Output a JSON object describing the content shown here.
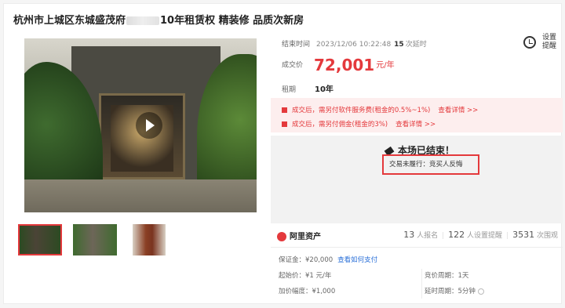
{
  "title_left": "杭州市上城区东城盛茂府",
  "title_right": "10年租赁权 精装修 品质次新房",
  "end_time": {
    "label": "结束时间",
    "value": "2023/12/06 10:22:48",
    "delay_count": "15",
    "delay_label": "次延时"
  },
  "price": {
    "label": "成交价",
    "value": "72,001",
    "unit": "元/年"
  },
  "term": {
    "label": "租期",
    "value": "10年"
  },
  "remind": {
    "label": "设置提醒",
    "icon": "alarm-clock-icon"
  },
  "fees": [
    {
      "text": "成交后，需另付软件服务费(租金的0.5%~1%)",
      "link": "查看详情 >>"
    },
    {
      "text": "成交后，需另付佣金(租金的3%)",
      "link": "查看详情 >>"
    }
  ],
  "ended": {
    "title": "本场已结束！",
    "reason": "交易未履行：竞买人反悔"
  },
  "brand": "阿里资产",
  "stats": {
    "signups": "13",
    "signups_label": "人报名",
    "reminders": "122",
    "reminders_label": "人设置提醒",
    "views": "3531",
    "views_label": "次围观"
  },
  "details": {
    "deposit_label": "保证金：¥20,000",
    "deposit_link": "查看如何支付",
    "start_label": "起始价：¥1 元/年",
    "bid_cycle": "竞价周期：1天",
    "increment": "加价幅度：¥1,000",
    "delay_cycle": "延时周期：5分钟"
  },
  "colors": {
    "accent": "#e4393c",
    "link": "#2b70d8"
  }
}
